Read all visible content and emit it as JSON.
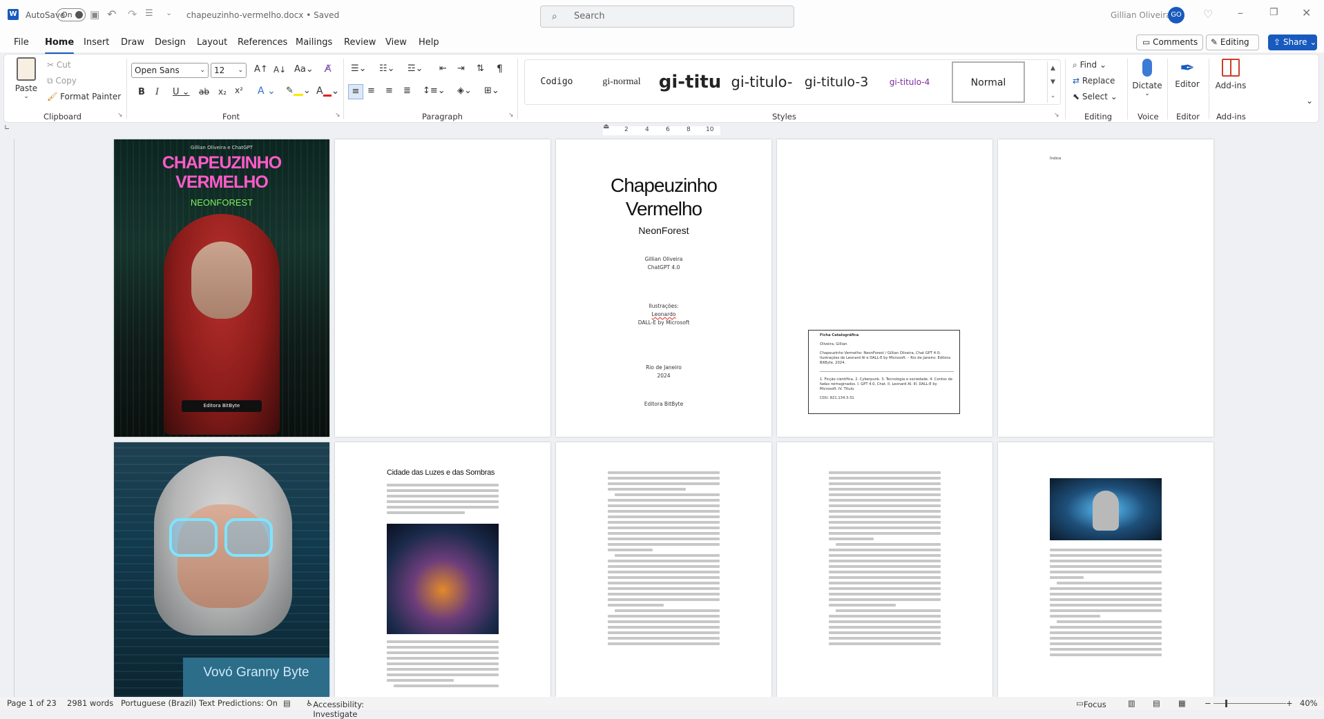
{
  "app": {
    "autosave_label": "AutoSave",
    "autosave_state": "On",
    "doc_title": "chapeuzinho-vermelho.docx • Saved",
    "search_placeholder": "Search",
    "user_name": "Gillian Oliveira",
    "user_initials": "GO"
  },
  "menu": [
    "File",
    "Home",
    "Insert",
    "Draw",
    "Design",
    "Layout",
    "References",
    "Mailings",
    "Review",
    "View",
    "Help"
  ],
  "menu_right": {
    "comments": "Comments",
    "editing": "Editing",
    "share": "Share"
  },
  "clipboard": {
    "paste": "Paste",
    "cut": "Cut",
    "copy": "Copy",
    "format_painter": "Format Painter",
    "label": "Clipboard"
  },
  "font": {
    "name": "Open Sans",
    "size": "12",
    "label": "Font"
  },
  "paragraph": {
    "label": "Paragraph"
  },
  "styles": {
    "items": [
      "Codigo",
      "gi-normal",
      "gi-titu",
      "gi-titulo-",
      "gi-titulo-3",
      "gi-titulo-4",
      "Normal"
    ],
    "label": "Styles"
  },
  "editing": {
    "find": "Find",
    "replace": "Replace",
    "select": "Select",
    "label": "Editing"
  },
  "voice": {
    "dictate": "Dictate",
    "label": "Voice"
  },
  "editor": {
    "name": "Editor",
    "label": "Editor"
  },
  "addins": {
    "name": "Add-ins",
    "label": "Add-ins"
  },
  "ruler": {
    "ticks": [
      "2",
      "4",
      "6",
      "8",
      "10"
    ]
  },
  "pages": {
    "cover1": {
      "authors": "Gillian Oliveira e ChatGPT",
      "title1": "CHAPEUZINHO",
      "title2": "VERMELHO",
      "subtitle": "NEONFOREST",
      "publisher": "Editora BitByte"
    },
    "title_page": {
      "t1": "Chapeuzinho",
      "t2": "Vermelho",
      "sub": "NeonForest",
      "a1": "Gillian Oliveira",
      "a2": "ChatGPT 4.0",
      "il": "Ilustrações:",
      "i1": "Leonardo",
      "i2": "DALL-E by Microsoft",
      "city": "Rio de Janeiro",
      "year": "2024",
      "pub": "Editora BitByte"
    },
    "catalog": {
      "head": "Ficha Catalográfica",
      "author": "Oliveira, Gillian",
      "desc": "Chapeuzinho Vermelho: NeonForest / Gillian Oliveira, Chat GPT 4.0; Ilustrações de Leonard AI e DALL-E by Microsoft. – Rio de Janeiro: Editora BitByte, 2024.",
      "topics": "1. Ficção científica. 2. Cyberpunk. 3. Tecnologia e sociedade. 4. Contos de fadas reimaginados. I. GPT 4.0, Chat. II. Leonard AI. III. DALL-E by Microsoft. IV. Título.",
      "cdu": "CDU: 821.134.3-31"
    },
    "index": {
      "label": "Índice"
    },
    "cover2": {
      "title": "Vovó Granny Byte"
    },
    "chapter": {
      "title": "Cidade das Luzes e das Sombras"
    }
  },
  "status": {
    "page": "Page 1 of 23",
    "words": "2981 words",
    "language": "Portuguese (Brazil)",
    "predictions": "Text Predictions: On",
    "accessibility": "Accessibility: Investigate",
    "focus": "Focus",
    "zoom": "40%"
  }
}
